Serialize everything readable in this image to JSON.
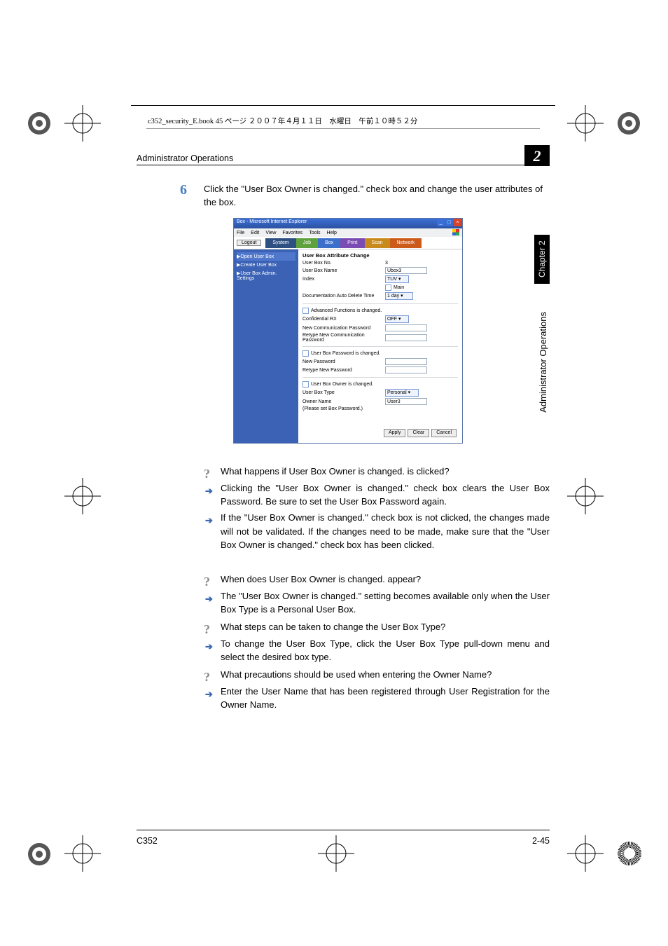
{
  "book_header": "c352_security_E.book  45 ページ  ２００７年４月１１日　水曜日　午前１０時５２分",
  "running_header": {
    "left": "Administrator Operations",
    "chip": "2"
  },
  "step": {
    "number": "6",
    "text": "Click the \"User Box Owner is changed.\" check box and change the user attributes of the box."
  },
  "screenshot": {
    "window_title": "Box - Microsoft Internet Explorer",
    "menus": [
      "File",
      "Edit",
      "View",
      "Favorites",
      "Tools",
      "Help"
    ],
    "logout": "Logout",
    "tabs": [
      "System",
      "Job",
      "Box",
      "Print",
      "Scan",
      "Network"
    ],
    "sidebar": [
      "▶Open User Box",
      "▶Create User Box",
      "▶User Box Admin. Settings"
    ],
    "section_title": "User Box Attribute Change",
    "fields": {
      "box_no_label": "User Box No.",
      "box_no_value": "3",
      "box_name_label": "User Box Name",
      "box_name_value": "Ubox3",
      "index_label": "Index",
      "index_value": "TUV",
      "main_label": "Main",
      "auto_del_label": "Documentation Auto Delete Time",
      "auto_del_value": "1 day",
      "adv_chk_label": "Advanced Functions is changed.",
      "conf_rx_label": "Confidential RX",
      "conf_rx_value": "OFF",
      "new_comm_pw_label": "New Communication Password",
      "retype_comm_pw_label": "Retype New Communication Password",
      "pw_chk_label": "User Box Password is changed.",
      "new_pw_label": "New Password",
      "retype_pw_label": "Retype New Password",
      "owner_chk_label": "User Box Owner is changed.",
      "box_type_label": "User Box Type",
      "box_type_value": "Personal",
      "owner_name_label": "Owner Name",
      "owner_name_value": "User3",
      "owner_hint": "(Please set Box Password.)"
    },
    "buttons": {
      "apply": "Apply",
      "clear": "Clear",
      "cancel": "Cancel"
    }
  },
  "qa": [
    {
      "type": "q",
      "text": "What happens if User Box Owner is changed. is clicked?"
    },
    {
      "type": "a",
      "text": "Clicking the \"User Box Owner is changed.\" check box clears the User Box Password. Be sure to set the User Box Password again."
    },
    {
      "type": "a",
      "text": "If the \"User Box Owner is changed.\" check box is not clicked, the changes made will not be validated. If the changes need to be made, make sure that the \"User Box Owner is changed.\" check box has been clicked."
    },
    {
      "type": "q",
      "text": "When does User Box Owner is changed. appear?"
    },
    {
      "type": "a",
      "text": "The \"User Box Owner is changed.\" setting becomes available only when the User Box Type is a Personal User Box."
    },
    {
      "type": "q",
      "text": "What steps can be taken to change the User Box Type?"
    },
    {
      "type": "a",
      "text": "To change the User Box Type, click the User Box Type pull-down menu and select the desired box type."
    },
    {
      "type": "q",
      "text": "What precautions should be used when entering the Owner Name?"
    },
    {
      "type": "a",
      "text": "Enter the User Name that has been registered through User Registration for the Owner Name."
    }
  ],
  "thumb_tab": "Chapter 2",
  "side_caption": "Administrator Operations",
  "footer": {
    "left": "C352",
    "right": "2-45"
  }
}
